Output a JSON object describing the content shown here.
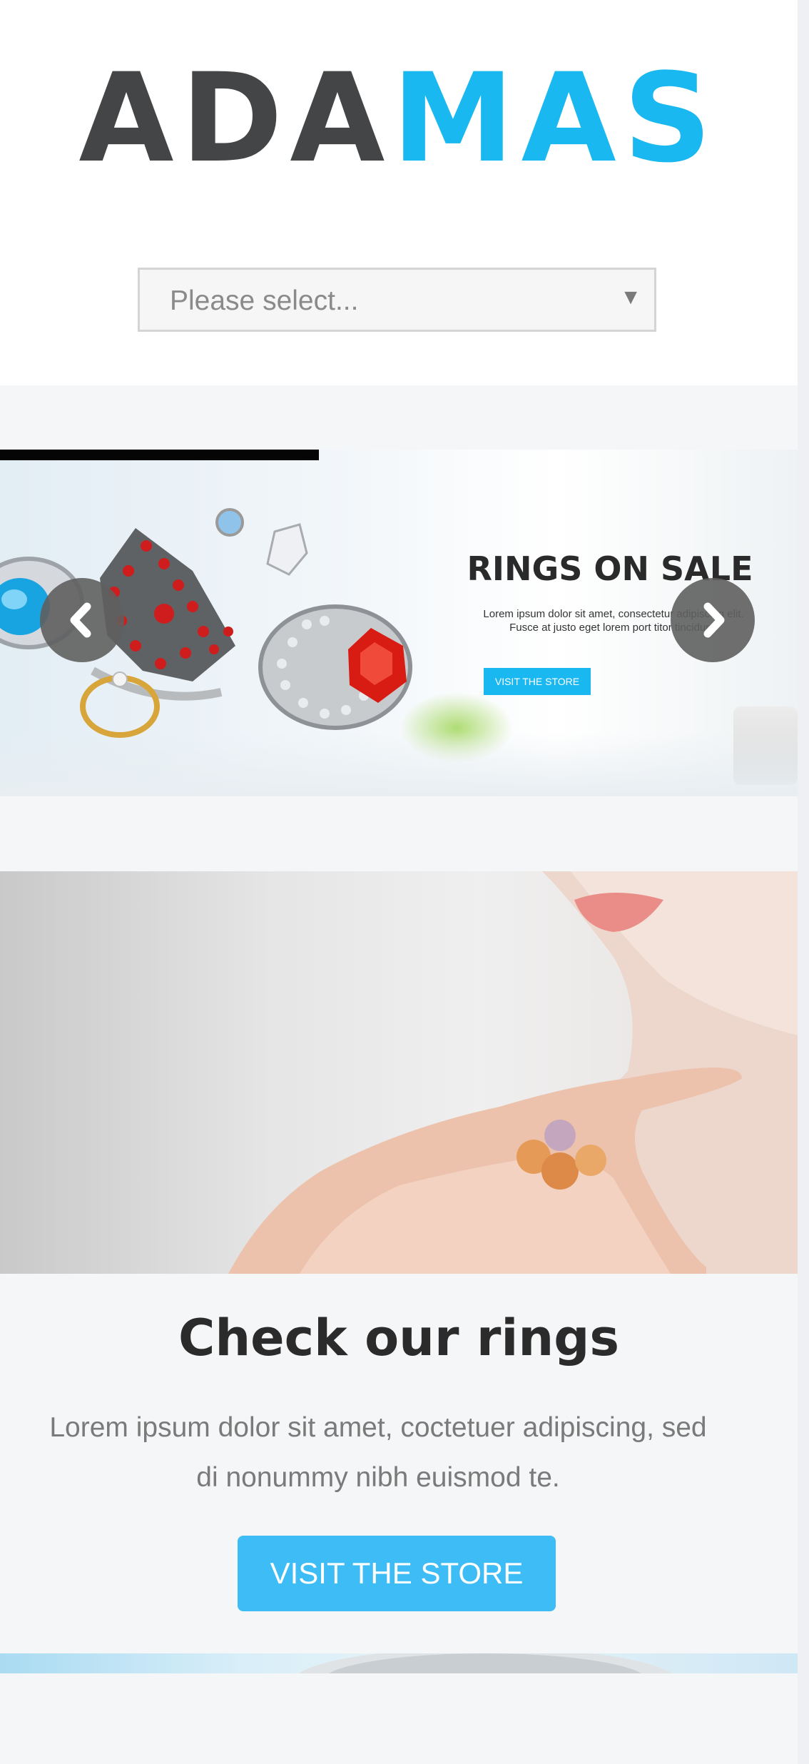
{
  "header": {
    "logo_part1": "ADA",
    "logo_part2": "MAS",
    "select_placeholder": "Please select...",
    "select_arrow": "▼"
  },
  "slider": {
    "title": "RINGS ON SALE",
    "text": "Lorem ipsum dolor sit amet, consectetur adipiscing elit. Fusce at justo eget lorem port titor tincidunt.",
    "button_label": "VISIT THE STORE",
    "prev_icon": "chevron-left-icon",
    "next_icon": "chevron-right-icon"
  },
  "promo": {
    "title": "Check our rings",
    "text": "Lorem ipsum dolor sit amet, coctetuer adipiscing, sed di nonummy nibh euismod te.",
    "button_label": "VISIT THE STORE"
  },
  "colors": {
    "brand_blue": "#1ab8f0",
    "logo_dark": "#444547",
    "button_blue": "#3dbcf5",
    "background": "#f5f6f8"
  }
}
